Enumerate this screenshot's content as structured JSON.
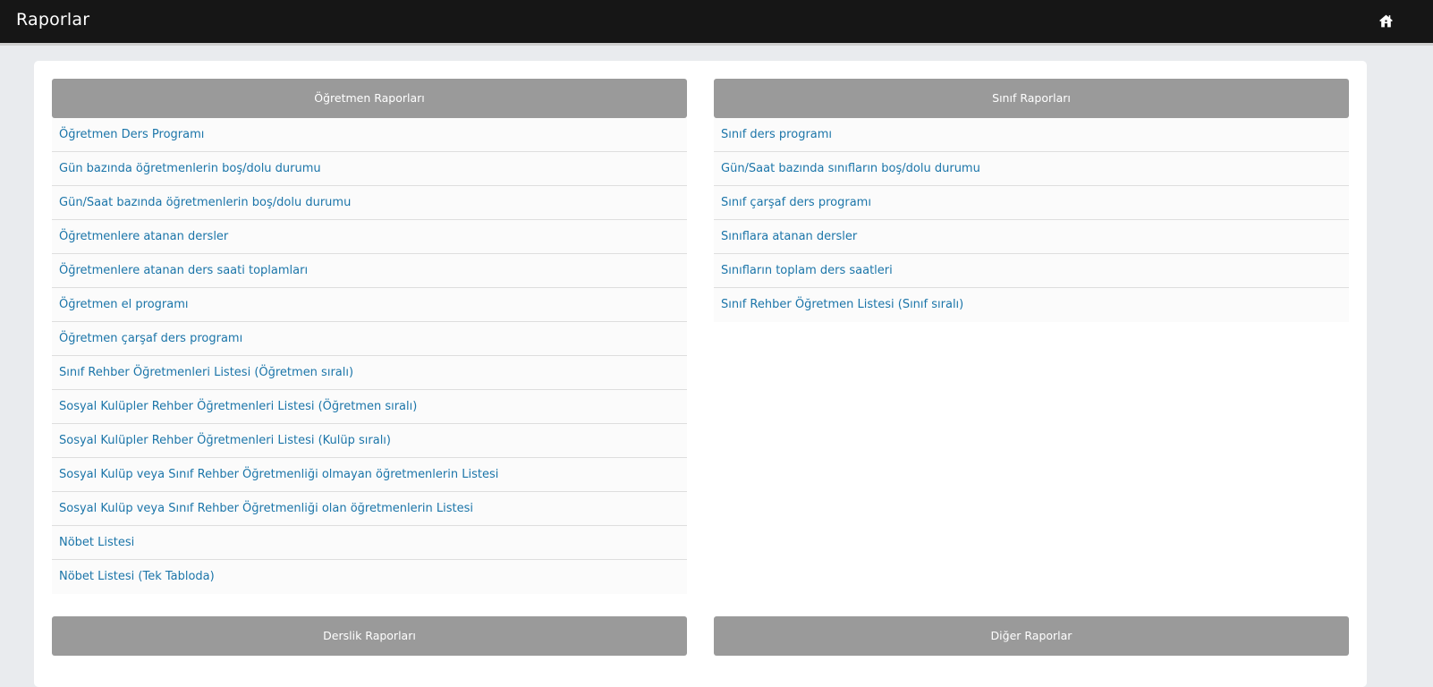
{
  "header": {
    "title": "Raporlar",
    "home_icon": "home-icon"
  },
  "sections": {
    "teacher": {
      "title": "Öğretmen Raporları",
      "items": [
        "Öğretmen Ders Programı",
        "Gün bazında öğretmenlerin boş/dolu durumu",
        "Gün/Saat bazında öğretmenlerin boş/dolu durumu",
        "Öğretmenlere atanan dersler",
        "Öğretmenlere atanan ders saati toplamları",
        "Öğretmen el programı",
        "Öğretmen çarşaf ders programı",
        "Sınıf Rehber Öğretmenleri Listesi (Öğretmen sıralı)",
        "Sosyal Kulüpler Rehber Öğretmenleri Listesi (Öğretmen sıralı)",
        "Sosyal Kulüpler Rehber Öğretmenleri Listesi (Kulüp sıralı)",
        "Sosyal Kulüp veya Sınıf Rehber Öğretmenliği olmayan öğretmenlerin Listesi",
        "Sosyal Kulüp veya Sınıf Rehber Öğretmenliği olan öğretmenlerin Listesi",
        "Nöbet Listesi",
        "Nöbet Listesi (Tek Tabloda)"
      ]
    },
    "class": {
      "title": "Sınıf Raporları",
      "items": [
        "Sınıf ders programı",
        "Gün/Saat bazında sınıfların boş/dolu durumu",
        "Sınıf çarşaf ders programı",
        "Sınıflara atanan dersler",
        "Sınıfların toplam ders saatleri",
        "Sınıf Rehber Öğretmen Listesi (Sınıf sıralı)"
      ]
    },
    "classroom": {
      "title": "Derslik Raporları"
    },
    "other": {
      "title": "Diğer Raporlar"
    }
  },
  "colors": {
    "topbar": "#161616",
    "background": "#e9ebee",
    "section_header": "#9a9a9a",
    "link": "#1b75a9"
  }
}
